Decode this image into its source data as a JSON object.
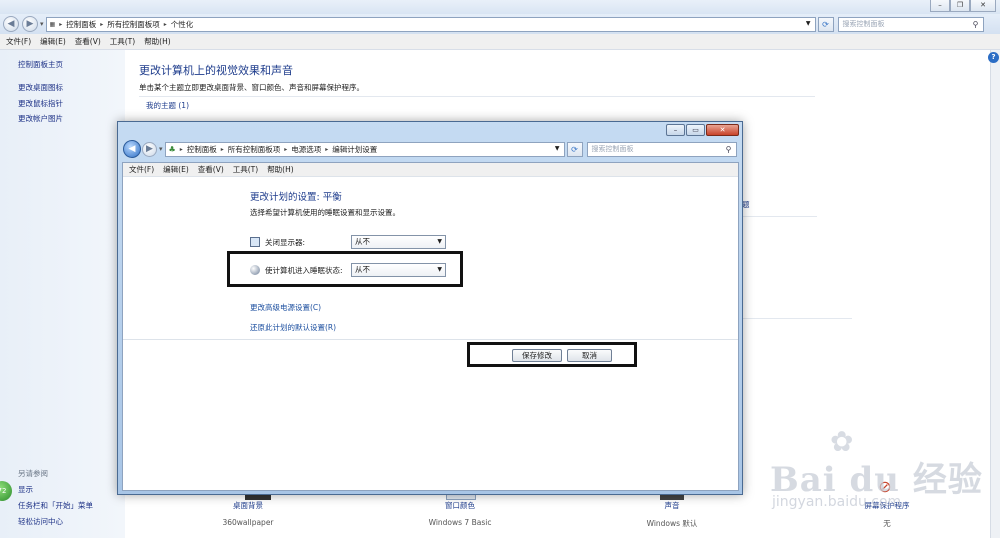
{
  "background_window": {
    "address": [
      "控制面板",
      "所有控制面板项",
      "个性化"
    ],
    "search_placeholder": "搜索控制面板",
    "menu": [
      "文件(F)",
      "编辑(E)",
      "查看(V)",
      "工具(T)",
      "帮助(H)"
    ],
    "sidebar": {
      "links": [
        "控制面板主页",
        "更改桌面图标",
        "更改鼠标指针",
        "更改帐户图片"
      ],
      "see_also_title": "另请参阅",
      "see_also": [
        "显示",
        "任务栏和「开始」菜单",
        "轻松访问中心"
      ]
    },
    "title": "更改计算机上的视觉效果和声音",
    "subtitle": "单击某个主题立即更改桌面背景、窗口颜色、声音和屏幕保护程序。",
    "my_themes": "我的主题 (1)",
    "fragment": "题",
    "bottom_items": [
      {
        "name": "桌面背景",
        "value": "360wallpaper"
      },
      {
        "name": "窗口颜色",
        "value": "Windows 7 Basic"
      },
      {
        "name": "声音",
        "value": "Windows 默认"
      },
      {
        "name": "屏幕保护程序",
        "value": "无"
      }
    ]
  },
  "foreground_window": {
    "address": [
      "控制面板",
      "所有控制面板项",
      "电源选项",
      "编辑计划设置"
    ],
    "search_placeholder": "搜索控制面板",
    "menu": [
      "文件(F)",
      "编辑(E)",
      "查看(V)",
      "工具(T)",
      "帮助(H)"
    ],
    "title": "更改计划的设置: 平衡",
    "subtitle": "选择希望计算机使用的睡眠设置和显示设置。",
    "display_off_label": "关闭显示器:",
    "display_off_value": "从不",
    "sleep_label": "使计算机进入睡眠状态:",
    "sleep_value": "从不",
    "advanced_link": "更改高级电源设置(C)",
    "restore_link": "还原此计划的默认设置(R)",
    "save_button": "保存修改",
    "cancel_button": "取消"
  },
  "watermark": {
    "logo": "Bai du 经验",
    "url": "jingyan.baidu.com"
  },
  "colors": {
    "link": "#1e3c8c",
    "highlight_border": "#111111",
    "close_button": "#c8432b"
  }
}
